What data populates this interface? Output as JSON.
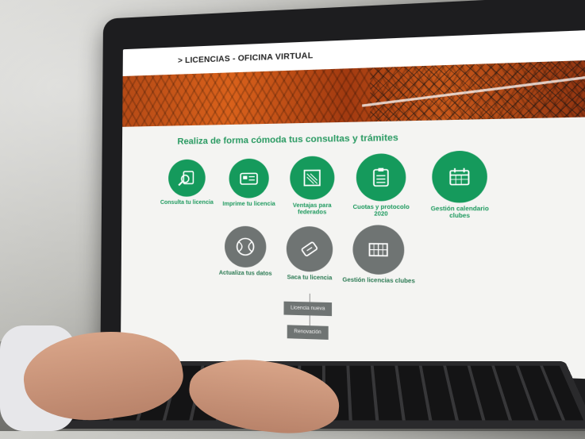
{
  "header": {
    "title": "> LICENCIAS - OFICINA VIRTUAL"
  },
  "headline": "Realiza de forma cómoda tus consultas y trámites",
  "tiles": [
    {
      "label": "Consulta tu licencia",
      "icon": "magnifier-card-icon",
      "color": "#159a5c"
    },
    {
      "label": "Imprime tu licencia",
      "icon": "id-card-icon",
      "color": "#159a5c"
    },
    {
      "label": "Ventajas para federados",
      "icon": "document-icon",
      "color": "#159a5c"
    },
    {
      "label": "Cuotas y protocolo 2020",
      "icon": "clipboard-checklist-icon",
      "color": "#159a5c"
    },
    {
      "label": "Gestión calendario clubes",
      "icon": "calendar-icon",
      "color": "#159a5c"
    },
    {
      "label": "Actualiza tus datos",
      "icon": "tennis-ball-icon",
      "color": "#6f7473"
    },
    {
      "label": "Saca tu licencia",
      "icon": "ticket-icon",
      "color": "#6f7473"
    },
    {
      "label": "Gestión licencias clubes",
      "icon": "tennis-court-icon",
      "color": "#6f7473"
    }
  ],
  "submenu": {
    "new_license": "Licencia nueva",
    "renewal": "Renovación"
  },
  "colors": {
    "accent": "#159a5c",
    "secondary": "#6f7473"
  }
}
